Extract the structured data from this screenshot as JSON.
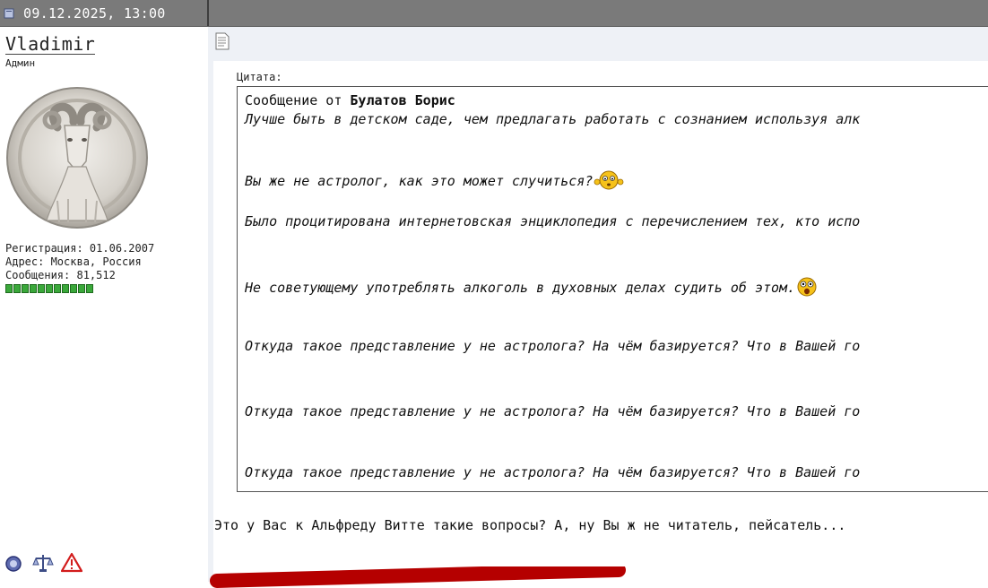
{
  "header": {
    "post_date": "09.12.2025, 13:00"
  },
  "author": {
    "name": "Vladimir",
    "rank": "Админ",
    "registration": "Регистрация: 01.06.2007",
    "address": "Адрес: Москва, Россия",
    "messages": "Сообщения: 81,512",
    "rank_level": 11
  },
  "quote": {
    "label": "Цитата:",
    "from_prefix": "Сообщение от ",
    "from_author": "Булатов Борис",
    "lines": [
      "Лучше быть в детском саде, чем предлагать работать с сознанием используя алк",
      "Вы же не астролог, как это может случиться?",
      "Было процитирована интернетовская энциклопедия с перечислением тех, кто испо",
      "Не советующему употреблять алкоголь в духовных делах судить об этом.",
      "Откуда такое представление у не астролога? На чём базируется? Что в Вашей го",
      "Откуда такое представление у не астролога? На чём базируется? Что в Вашей го",
      "Откуда такое представление у не астролога? На чём базируется? Что в Вашей го"
    ]
  },
  "reply": {
    "text": "Это у Вас к Альфреду Витте такие вопросы? А, ну Вы ж не читатель, пейсатель..."
  },
  "colors": {
    "rank_bar": "#3aa83a",
    "annotation_line": "#b50000",
    "topbar": "#7a7a7a"
  }
}
